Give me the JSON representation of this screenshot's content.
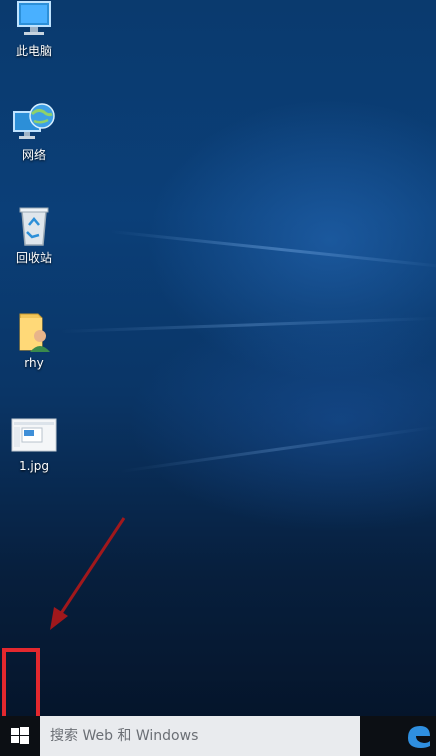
{
  "desktop": {
    "icons": [
      {
        "label": "此电脑",
        "icon": "this-pc-icon"
      },
      {
        "label": "网络",
        "icon": "network-icon"
      },
      {
        "label": "回收站",
        "icon": "recycle-bin-icon"
      },
      {
        "label": "rhy",
        "icon": "user-folder-icon"
      },
      {
        "label": "1.jpg",
        "icon": "image-file-icon"
      }
    ]
  },
  "taskbar": {
    "start_icon": "windows-logo-icon",
    "search_placeholder": "搜索 Web 和 Windows",
    "tray_icon": "edge-browser-icon"
  },
  "annotation": {
    "highlight_color": "#e3282e",
    "arrow_color": "#a0181c"
  }
}
